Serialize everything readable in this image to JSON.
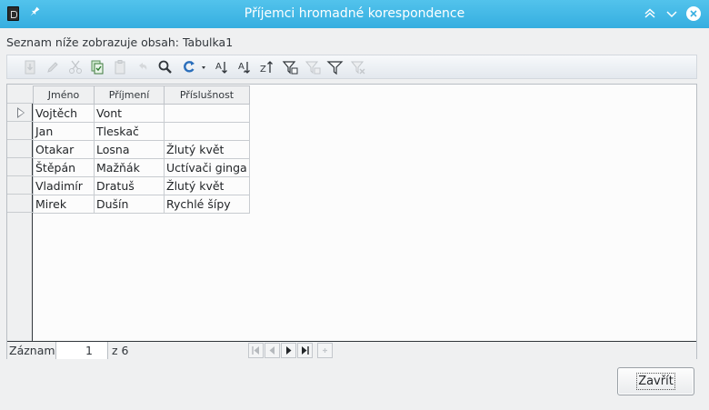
{
  "window": {
    "title": "Příjemci hromadné korespondence"
  },
  "caption": "Seznam níže zobrazuje obsah: Tabulka1",
  "toolbar": {
    "icons": [
      "save-record-icon",
      "edit-icon",
      "cut-icon",
      "copy-icon",
      "paste-icon",
      "undo-icon",
      "find-icon",
      "refresh-icon",
      "sort-ascending-icon",
      "sort-descending-icon",
      "sort-icon",
      "autofilter-icon",
      "apply-filter-icon",
      "standard-filter-icon",
      "reset-filter-icon"
    ]
  },
  "grid": {
    "columns": [
      "Jméno",
      "Příjmení",
      "Příslušnost"
    ],
    "rows": [
      [
        "Vojtěch",
        "Vont",
        ""
      ],
      [
        "Jan",
        "Tleskač",
        ""
      ],
      [
        "Otakar",
        "Losna",
        "Žlutý květ"
      ],
      [
        "Štěpán",
        "Mažňák",
        "Uctívači ginga"
      ],
      [
        "Vladimír",
        "Dratuš",
        "Žlutý květ"
      ],
      [
        "Mirek",
        "Dušín",
        "Rychlé šípy"
      ]
    ],
    "current_row": 1
  },
  "navigator": {
    "record_label": "Záznam",
    "record_value": "1",
    "of_label": "z 6"
  },
  "close_button": "Zavřít"
}
